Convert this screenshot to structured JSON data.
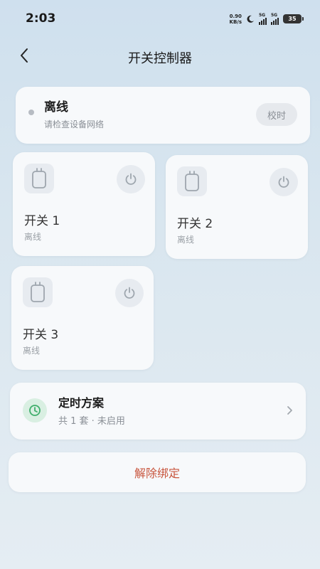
{
  "status_bar": {
    "time": "2:03",
    "net_speed_value": "0.90",
    "net_speed_unit": "KB/s",
    "sim1_label": "5G",
    "sim2_label": "5G",
    "battery": "35"
  },
  "header": {
    "back_icon": "chevron-left-icon",
    "title": "开关控制器"
  },
  "device_status": {
    "title": "离线",
    "subtitle": "请检查设备网络",
    "sync_button": "校时"
  },
  "switches": [
    {
      "name": "开关 1",
      "state": "离线",
      "icon": "switch-icon",
      "power_icon": "power-icon"
    },
    {
      "name": "开关 2",
      "state": "离线",
      "icon": "switch-icon",
      "power_icon": "power-icon"
    },
    {
      "name": "开关 3",
      "state": "离线",
      "icon": "switch-icon",
      "power_icon": "power-icon"
    }
  ],
  "timer": {
    "title": "定时方案",
    "subtitle": "共 1 套 · 未启用",
    "icon": "clock-icon"
  },
  "unbind_label": "解除绑定",
  "colors": {
    "offline_dot": "#b7bcc3",
    "danger_text": "#c8553d",
    "clock_green": "#3fae6b"
  }
}
